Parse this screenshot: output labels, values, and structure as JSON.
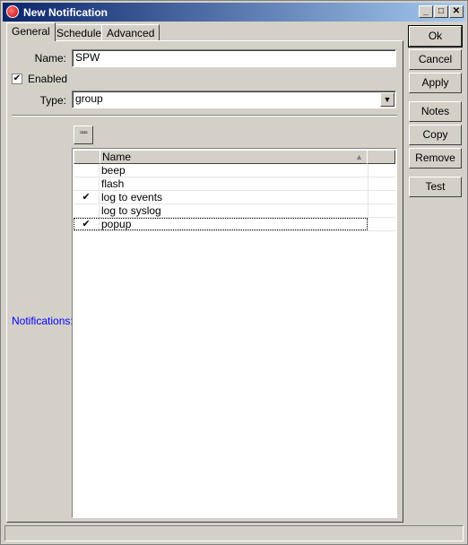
{
  "window": {
    "title": "New Notification"
  },
  "title_buttons": {
    "minimize": "_",
    "maximize": "□",
    "close": "✕"
  },
  "tabs": [
    {
      "label": "General",
      "active": true
    },
    {
      "label": "Schedule",
      "active": false
    },
    {
      "label": "Advanced",
      "active": false
    }
  ],
  "form": {
    "name_label": "Name:",
    "name_value": "SPW",
    "enabled_label": "Enabled",
    "enabled_checked": true,
    "type_label": "Type:",
    "type_value": "group",
    "notifications_label": "Notifications:"
  },
  "list": {
    "menu_button": "▫▫▫",
    "column_header": "Name",
    "sort_icon": "sort-ascending-icon",
    "rows": [
      {
        "name": "beep",
        "checked": false
      },
      {
        "name": "flash",
        "checked": false
      },
      {
        "name": "log to events",
        "checked": true
      },
      {
        "name": "log to syslog",
        "checked": false
      },
      {
        "name": "popup",
        "checked": true
      }
    ]
  },
  "buttons": {
    "ok": "Ok",
    "cancel": "Cancel",
    "apply": "Apply",
    "notes": "Notes",
    "copy": "Copy",
    "remove": "Remove",
    "test": "Test"
  },
  "colors": {
    "title_start": "#0a246a",
    "title_end": "#a6caf0",
    "notifications_label": "#0000ff",
    "face": "#d4d0c8"
  }
}
